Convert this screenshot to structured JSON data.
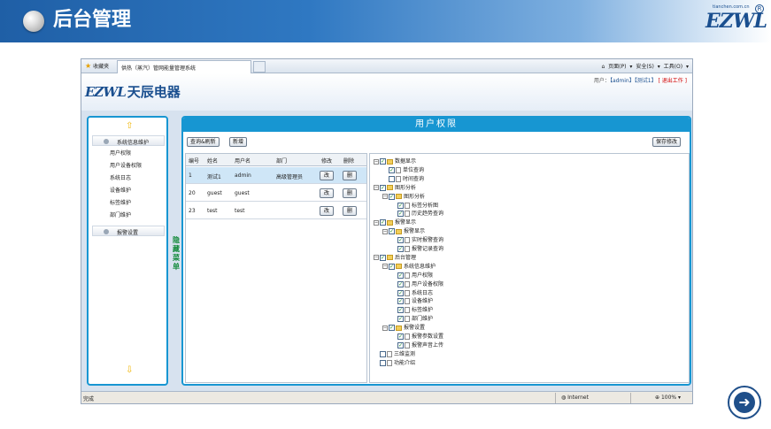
{
  "slide": {
    "title": "后台管理"
  },
  "logo": {
    "text": "EZWL",
    "small": "tianchen.com.cn",
    "reg": "R"
  },
  "browser": {
    "favorites": "收藏夹",
    "tab_title": "供热（蒸汽）管网能量管理系统",
    "commands": {
      "page": "页面(P) ▾",
      "safety": "安全(S) ▾",
      "tools": "工具(O) ▾",
      "home_icon": "home-icon"
    }
  },
  "app": {
    "logo_en": "EZWL",
    "logo_cn": "天辰电器",
    "user_line": {
      "prefix": "用户：",
      "user": "【admin】",
      "role": "【测试1】",
      "exit": "[ 退出工作 ]"
    }
  },
  "left_menu": {
    "up_arrow": "⇧",
    "down_arrow": "⇩",
    "group1": "系统信息维护",
    "items": [
      "用户权限",
      "用户设备权限",
      "系统日志",
      "设备维护",
      "标签维护",
      "部门维护"
    ],
    "group2": "报警设置",
    "hide_label": "隐藏菜单"
  },
  "main": {
    "title": "用户权限",
    "btn_query": "查询&刷新",
    "btn_add": "新增",
    "btn_save": "保存修改",
    "columns": [
      "编号",
      "姓名",
      "用户名",
      "部门",
      "修改",
      "删除"
    ],
    "rows": [
      {
        "id": "1",
        "name": "测试1",
        "username": "admin",
        "dept": "高级管理员",
        "edit": "改",
        "del": "删"
      },
      {
        "id": "20",
        "name": "guest",
        "username": "guest",
        "dept": "",
        "edit": "改",
        "del": "删"
      },
      {
        "id": "23",
        "name": "test",
        "username": "test",
        "dept": "",
        "edit": "改",
        "del": "删"
      }
    ],
    "tree": [
      {
        "label": "数据显示",
        "level": 0,
        "type": "folder",
        "checked": true
      },
      {
        "label": "单位查询",
        "level": 1,
        "type": "file",
        "checked": true
      },
      {
        "label": "时间查询",
        "level": 1,
        "type": "file",
        "checked": false
      },
      {
        "label": "图形分析",
        "level": 0,
        "type": "folder",
        "checked": true
      },
      {
        "label": "图形分析",
        "level": 1,
        "type": "folder",
        "checked": true
      },
      {
        "label": "标签分析图",
        "level": 2,
        "type": "file",
        "checked": true
      },
      {
        "label": "历史趋势查询",
        "level": 2,
        "type": "file",
        "checked": true
      },
      {
        "label": "报警显示",
        "level": 0,
        "type": "folder",
        "checked": true
      },
      {
        "label": "报警显示",
        "level": 1,
        "type": "folder",
        "checked": true
      },
      {
        "label": "实时报警查询",
        "level": 2,
        "type": "file",
        "checked": true
      },
      {
        "label": "报警记录查询",
        "level": 2,
        "type": "file",
        "checked": true
      },
      {
        "label": "后台管理",
        "level": 0,
        "type": "folder",
        "checked": true
      },
      {
        "label": "系统信息维护",
        "level": 1,
        "type": "folder",
        "checked": true
      },
      {
        "label": "用户权限",
        "level": 2,
        "type": "file",
        "checked": true
      },
      {
        "label": "用户设备权限",
        "level": 2,
        "type": "file",
        "checked": true
      },
      {
        "label": "系统日志",
        "level": 2,
        "type": "file",
        "checked": true
      },
      {
        "label": "设备维护",
        "level": 2,
        "type": "file",
        "checked": true
      },
      {
        "label": "标签维护",
        "level": 2,
        "type": "file",
        "checked": true
      },
      {
        "label": "部门维护",
        "level": 2,
        "type": "file",
        "checked": true
      },
      {
        "label": "报警设置",
        "level": 1,
        "type": "folder",
        "checked": true
      },
      {
        "label": "报警参数设置",
        "level": 2,
        "type": "file",
        "checked": true
      },
      {
        "label": "报警声音上传",
        "level": 2,
        "type": "file",
        "checked": true
      },
      {
        "label": "三维监测",
        "level": 0,
        "type": "file",
        "checked": false
      },
      {
        "label": "功能介绍",
        "level": 0,
        "type": "file",
        "checked": false
      }
    ]
  },
  "status": {
    "done": "完成",
    "zone": "Internet",
    "zoom": "100%"
  },
  "next_icon": "arrow-right-circle-icon",
  "colors": {
    "accent": "#1796d2",
    "header": "#1f5fa6",
    "checkmark": "#178a2a"
  }
}
